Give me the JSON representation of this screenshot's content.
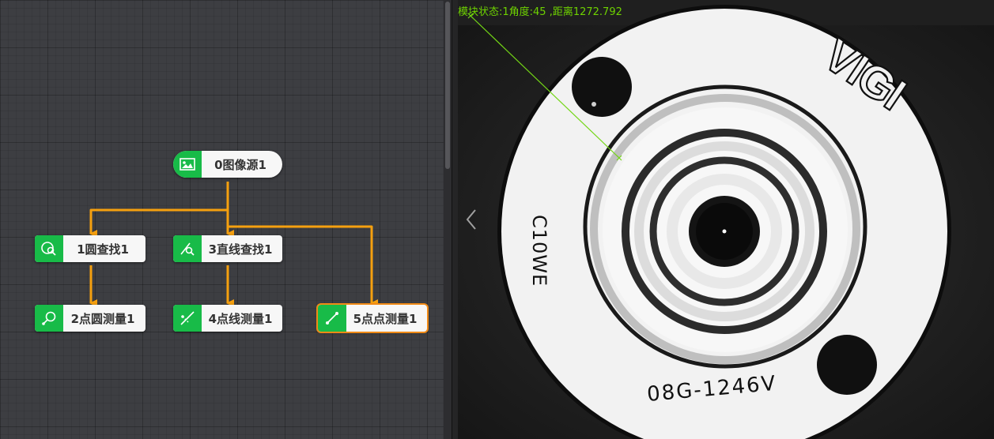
{
  "flow": {
    "nodes": [
      {
        "id": "n0",
        "label": "0图像源1",
        "icon": "image-icon"
      },
      {
        "id": "n1",
        "label": "1圆查找1",
        "icon": "circle-search-icon"
      },
      {
        "id": "n3",
        "label": "3直线查找1",
        "icon": "line-search-icon"
      },
      {
        "id": "n2",
        "label": "2点圆测量1",
        "icon": "point-circle-measure-icon"
      },
      {
        "id": "n4",
        "label": "4点线测量1",
        "icon": "point-line-measure-icon"
      },
      {
        "id": "n5",
        "label": "5点点测量1",
        "icon": "point-point-measure-icon"
      }
    ],
    "selected": "n5",
    "connector_color": "#f5a00f",
    "icon_bg_color": "#18bb48"
  },
  "viewer": {
    "status_text": "模块状态:1角度:45 ,距离1272.792",
    "status_color": "#6ed200",
    "prev_icon": "chevron-left-icon",
    "part_text": {
      "logo": "VIGI",
      "code_side": "C10WE",
      "code_bottom": "08G-1246V"
    }
  }
}
